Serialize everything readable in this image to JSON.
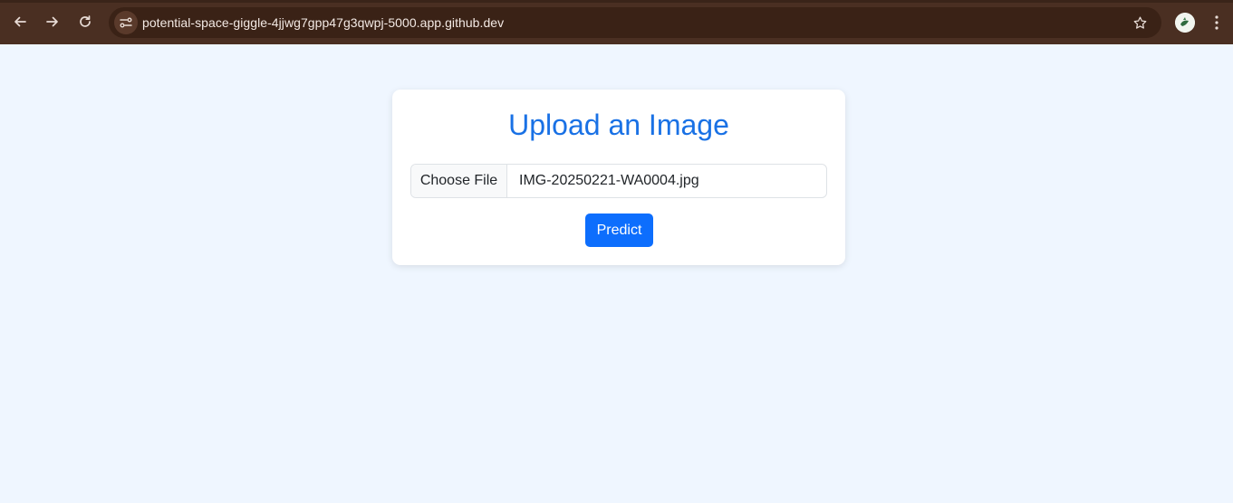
{
  "browser": {
    "url": "potential-space-giggle-4jjwg7gpp47g3qwpj-5000.app.github.dev",
    "icons": {
      "back": "back-arrow-icon",
      "forward": "forward-arrow-icon",
      "reload": "reload-icon",
      "site_info": "site-settings-icon",
      "bookmark": "star-icon",
      "profile": "profile-avatar-icon",
      "menu": "kebab-menu-icon"
    },
    "colors": {
      "toolbar": "#4a2f22",
      "omnibox": "#3a2216"
    }
  },
  "page": {
    "title": "Upload an Image",
    "file_input": {
      "button_label": "Choose File",
      "file_name": "IMG-20250221-WA0004.jpg"
    },
    "predict_label": "Predict",
    "colors": {
      "background": "#eff6ff",
      "title": "#1971e5",
      "primary": "#0d6efd"
    }
  }
}
